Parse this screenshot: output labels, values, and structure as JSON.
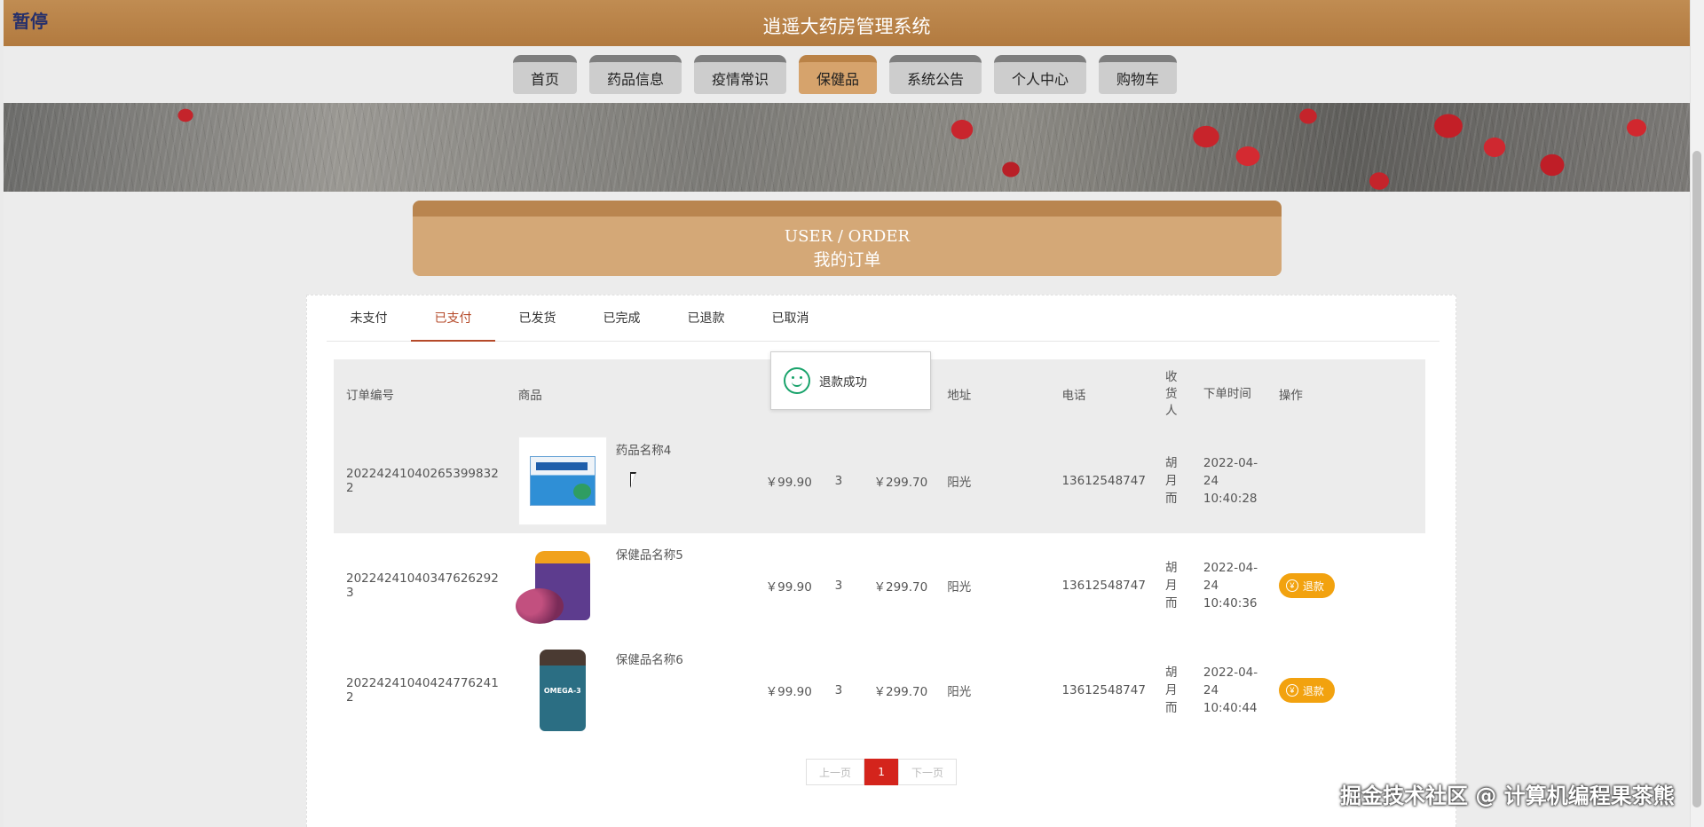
{
  "header": {
    "title": "逍遥大药房管理系统",
    "pause": "暂停"
  },
  "nav": [
    {
      "label": "首页",
      "active": false
    },
    {
      "label": "药品信息",
      "active": false
    },
    {
      "label": "疫情常识",
      "active": false
    },
    {
      "label": "保健品",
      "active": true
    },
    {
      "label": "系统公告",
      "active": false
    },
    {
      "label": "个人中心",
      "active": false
    },
    {
      "label": "购物车",
      "active": false
    }
  ],
  "section": {
    "en": "USER / ORDER",
    "cn": "我的订单"
  },
  "tabs": [
    {
      "label": "未支付",
      "active": false
    },
    {
      "label": "已支付",
      "active": true
    },
    {
      "label": "已发货",
      "active": false
    },
    {
      "label": "已完成",
      "active": false
    },
    {
      "label": "已退款",
      "active": false
    },
    {
      "label": "已取消",
      "active": false
    }
  ],
  "table": {
    "columns": [
      "订单编号",
      "商品",
      "",
      "",
      "",
      "地址",
      "电话",
      "收货人",
      "下单时间",
      "操作"
    ],
    "rows": [
      {
        "order_no": "20224241040265399832​2",
        "goods": "药品名称4",
        "price": "￥99.90",
        "qty": "3",
        "total": "￥299.70",
        "address": "阳光",
        "phone": "13612548747",
        "receiver": "胡月而",
        "time": "2022-04-24 10:40:28",
        "action": "",
        "thumb": "box",
        "hover": true
      },
      {
        "order_no": "20224241040347626292​3",
        "goods": "保健品名称5",
        "price": "￥99.90",
        "qty": "3",
        "total": "￥299.70",
        "address": "阳光",
        "phone": "13612548747",
        "receiver": "胡月而",
        "time": "2022-04-24 10:40:36",
        "action": "退款",
        "thumb": "grape",
        "hover": false
      },
      {
        "order_no": "20224241040424776241​2",
        "goods": "保健品名称6",
        "price": "￥99.90",
        "qty": "3",
        "total": "￥299.70",
        "address": "阳光",
        "phone": "13612548747",
        "receiver": "胡月而",
        "time": "2022-04-24 10:40:44",
        "action": "退款",
        "thumb": "omega",
        "hover": false
      }
    ]
  },
  "toast": {
    "text": "退款成功"
  },
  "pager": {
    "prev": "上一页",
    "current": "1",
    "next": "下一页"
  },
  "watermark": "掘金技术社区 @ 计算机编程果茶熊",
  "icons": {
    "toast": "smile-icon",
    "refund": "yen-icon",
    "cursor": "cursor-icon"
  },
  "colors": {
    "header": "#b27a3f",
    "active_nav": "#d6a36c",
    "active_tab": "#b54a2a",
    "refund": "#f2a20f",
    "pager_current": "#d4241c",
    "toast_icon": "#19a36b"
  }
}
